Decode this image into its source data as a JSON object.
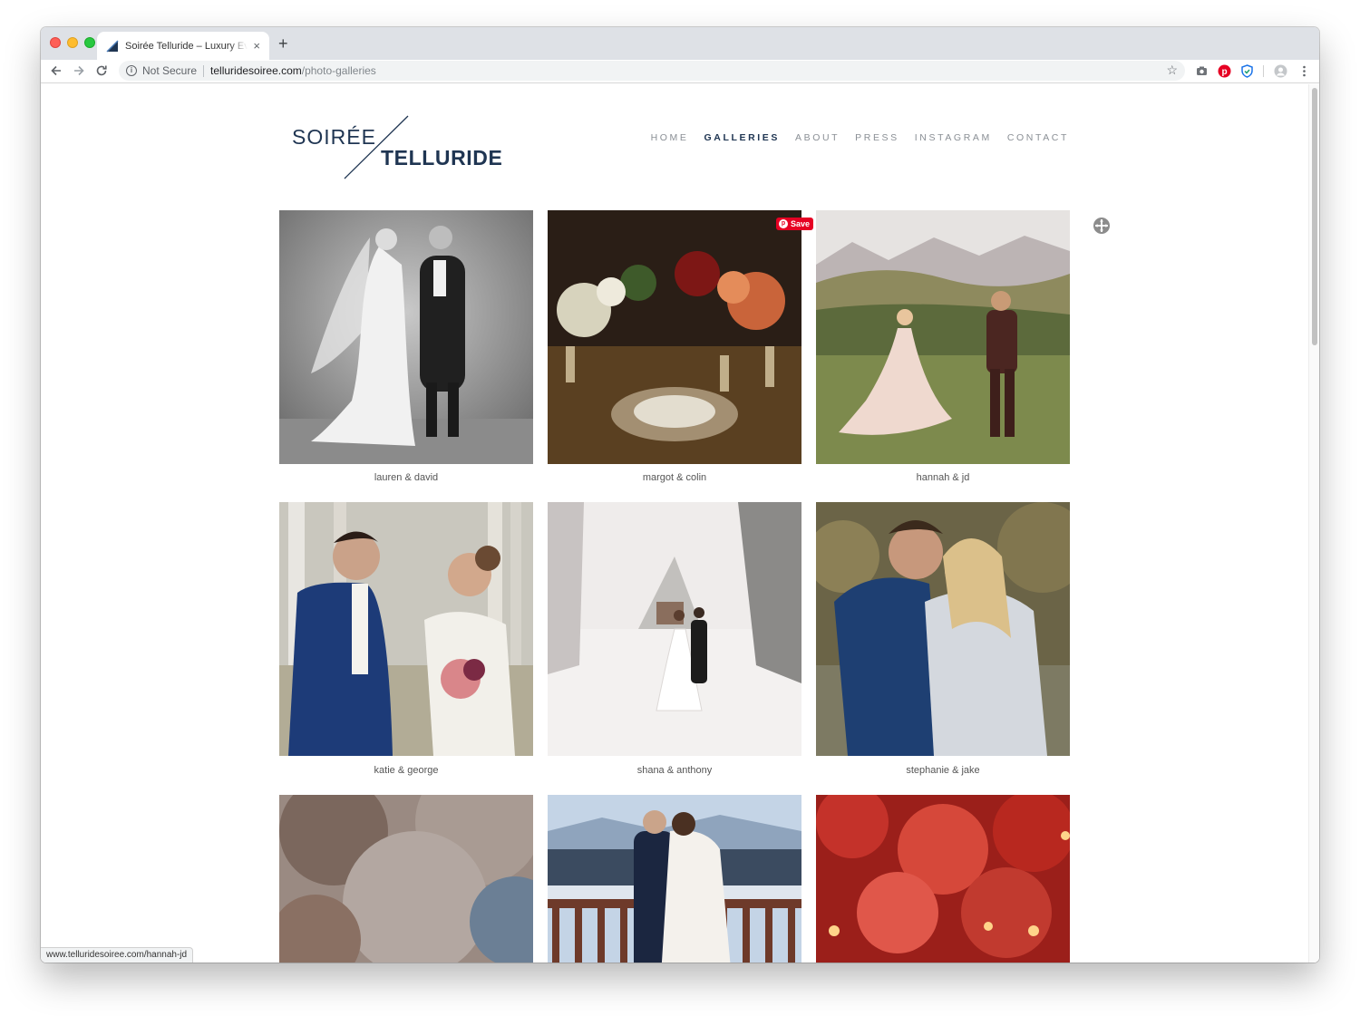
{
  "browser": {
    "tab_title": "Soirée Telluride – Luxury Event",
    "tab_close": "×",
    "new_tab": "+",
    "security_label": "Not Secure",
    "url_host": "telluridesoiree.com",
    "url_path": "/photo-galleries",
    "status_url": "www.telluridesoiree.com/hannah-jd"
  },
  "logo": {
    "line1": "SOIRÉE",
    "line2": "TELLURIDE"
  },
  "nav": {
    "items": [
      {
        "label": "HOME"
      },
      {
        "label": "GALLERIES"
      },
      {
        "label": "ABOUT"
      },
      {
        "label": "PRESS"
      },
      {
        "label": "INSTAGRAM"
      },
      {
        "label": "CONTACT"
      }
    ],
    "active": "GALLERIES"
  },
  "pin_save_label": "Save",
  "galleries": [
    {
      "caption": "lauren & david"
    },
    {
      "caption": "margot & colin"
    },
    {
      "caption": "hannah & jd"
    },
    {
      "caption": "katie & george"
    },
    {
      "caption": "shana & anthony"
    },
    {
      "caption": "stephanie & jake"
    },
    {
      "caption": ""
    },
    {
      "caption": ""
    },
    {
      "caption": ""
    }
  ],
  "colors": {
    "brand_navy": "#1f3552",
    "pinterest_red": "#e60023"
  }
}
